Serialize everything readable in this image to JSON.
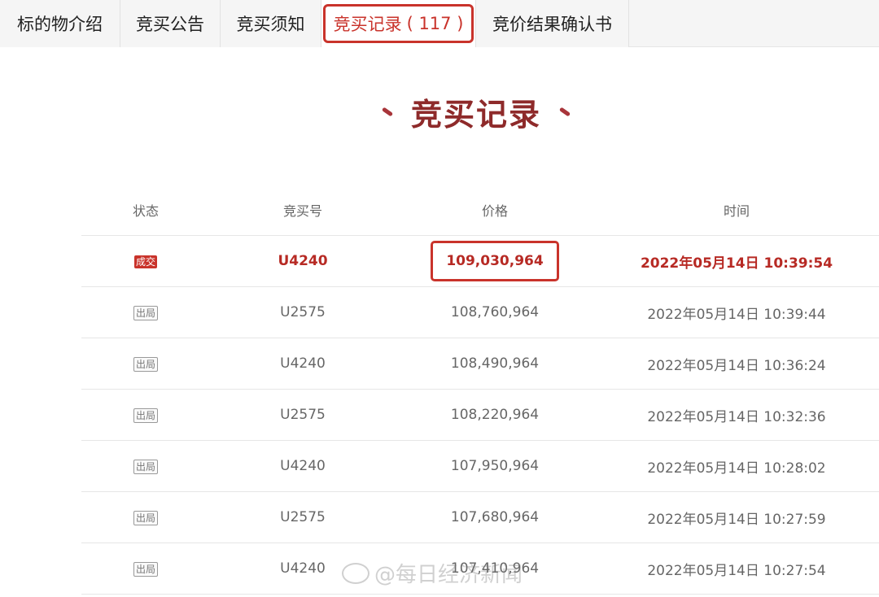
{
  "tabs": [
    {
      "label": "标的物介绍"
    },
    {
      "label": "竞买公告"
    },
    {
      "label": "竞买须知"
    },
    {
      "label": "竞买记录",
      "count": "( 117 )"
    },
    {
      "label": "竞价结果确认书"
    }
  ],
  "section": {
    "title": "竞买记录"
  },
  "table": {
    "headers": {
      "status": "状态",
      "bid_no": "竞买号",
      "price": "价格",
      "time": "时间"
    },
    "rows": [
      {
        "status": "成交",
        "bid_no": "U4240",
        "price": "109,030,964",
        "time": "2022年05月14日 10:39:54"
      },
      {
        "status": "出局",
        "bid_no": "U2575",
        "price": "108,760,964",
        "time": "2022年05月14日 10:39:44"
      },
      {
        "status": "出局",
        "bid_no": "U4240",
        "price": "108,490,964",
        "time": "2022年05月14日 10:36:24"
      },
      {
        "status": "出局",
        "bid_no": "U2575",
        "price": "108,220,964",
        "time": "2022年05月14日 10:32:36"
      },
      {
        "status": "出局",
        "bid_no": "U4240",
        "price": "107,950,964",
        "time": "2022年05月14日 10:28:02"
      },
      {
        "status": "出局",
        "bid_no": "U2575",
        "price": "107,680,964",
        "time": "2022年05月14日 10:27:59"
      },
      {
        "status": "出局",
        "bid_no": "U4240",
        "price": "107,410,964",
        "time": "2022年05月14日 10:27:54"
      }
    ]
  },
  "watermark": "@每日经济新闻",
  "colors": {
    "accent": "#c9332b",
    "title": "#8e2a2a"
  }
}
